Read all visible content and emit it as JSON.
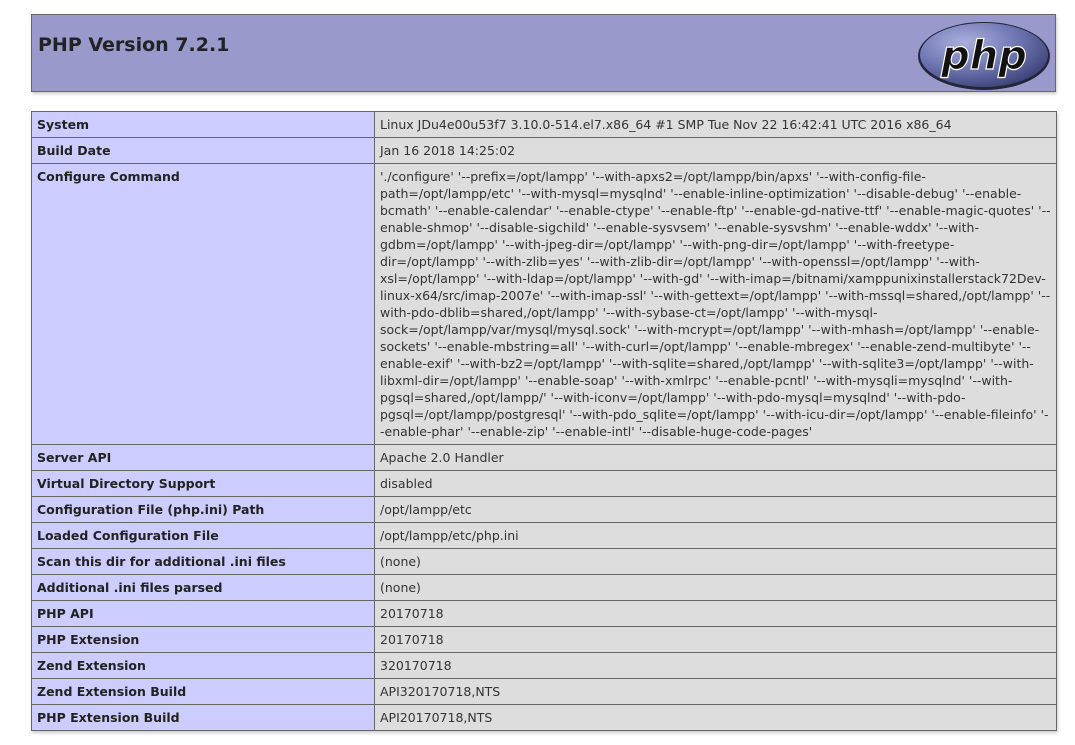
{
  "header": {
    "title": "PHP Version 7.2.1",
    "logo_text": "php"
  },
  "colors": {
    "header_bg": "#9999cc",
    "label_bg": "#ccccff",
    "value_bg": "#dddddd",
    "border": "#666666"
  },
  "rows": [
    {
      "label": "System",
      "value": "Linux JDu4e00u53f7 3.10.0-514.el7.x86_64 #1 SMP Tue Nov 22 16:42:41 UTC 2016 x86_64"
    },
    {
      "label": "Build Date",
      "value": "Jan 16 2018 14:25:02"
    },
    {
      "label": "Configure Command",
      "value": "'./configure' '--prefix=/opt/lampp' '--with-apxs2=/opt/lampp/bin/apxs' '--with-config-file-path=/opt/lampp/etc' '--with-mysql=mysqlnd' '--enable-inline-optimization' '--disable-debug' '--enable-bcmath' '--enable-calendar' '--enable-ctype' '--enable-ftp' '--enable-gd-native-ttf' '--enable-magic-quotes' '--enable-shmop' '--disable-sigchild' '--enable-sysvsem' '--enable-sysvshm' '--enable-wddx' '--with-gdbm=/opt/lampp' '--with-jpeg-dir=/opt/lampp' '--with-png-dir=/opt/lampp' '--with-freetype-dir=/opt/lampp' '--with-zlib=yes' '--with-zlib-dir=/opt/lampp' '--with-openssl=/opt/lampp' '--with-xsl=/opt/lampp' '--with-ldap=/opt/lampp' '--with-gd' '--with-imap=/bitnami/xamppunixinstallerstack72Dev-linux-x64/src/imap-2007e' '--with-imap-ssl' '--with-gettext=/opt/lampp' '--with-mssql=shared,/opt/lampp' '--with-pdo-dblib=shared,/opt/lampp' '--with-sybase-ct=/opt/lampp' '--with-mysql-sock=/opt/lampp/var/mysql/mysql.sock' '--with-mcrypt=/opt/lampp' '--with-mhash=/opt/lampp' '--enable-sockets' '--enable-mbstring=all' '--with-curl=/opt/lampp' '--enable-mbregex' '--enable-zend-multibyte' '--enable-exif' '--with-bz2=/opt/lampp' '--with-sqlite=shared,/opt/lampp' '--with-sqlite3=/opt/lampp' '--with-libxml-dir=/opt/lampp' '--enable-soap' '--with-xmlrpc' '--enable-pcntl' '--with-mysqli=mysqlnd' '--with-pgsql=shared,/opt/lampp/' '--with-iconv=/opt/lampp' '--with-pdo-mysql=mysqlnd' '--with-pdo-pgsql=/opt/lampp/postgresql' '--with-pdo_sqlite=/opt/lampp' '--with-icu-dir=/opt/lampp' '--enable-fileinfo' '--enable-phar' '--enable-zip' '--enable-intl' '--disable-huge-code-pages'"
    },
    {
      "label": "Server API",
      "value": "Apache 2.0 Handler"
    },
    {
      "label": "Virtual Directory Support",
      "value": "disabled"
    },
    {
      "label": "Configuration File (php.ini) Path",
      "value": "/opt/lampp/etc"
    },
    {
      "label": "Loaded Configuration File",
      "value": "/opt/lampp/etc/php.ini"
    },
    {
      "label": "Scan this dir for additional .ini files",
      "value": "(none)"
    },
    {
      "label": "Additional .ini files parsed",
      "value": "(none)"
    },
    {
      "label": "PHP API",
      "value": "20170718"
    },
    {
      "label": "PHP Extension",
      "value": "20170718"
    },
    {
      "label": "Zend Extension",
      "value": "320170718"
    },
    {
      "label": "Zend Extension Build",
      "value": "API320170718,NTS"
    },
    {
      "label": "PHP Extension Build",
      "value": "API20170718,NTS"
    }
  ]
}
